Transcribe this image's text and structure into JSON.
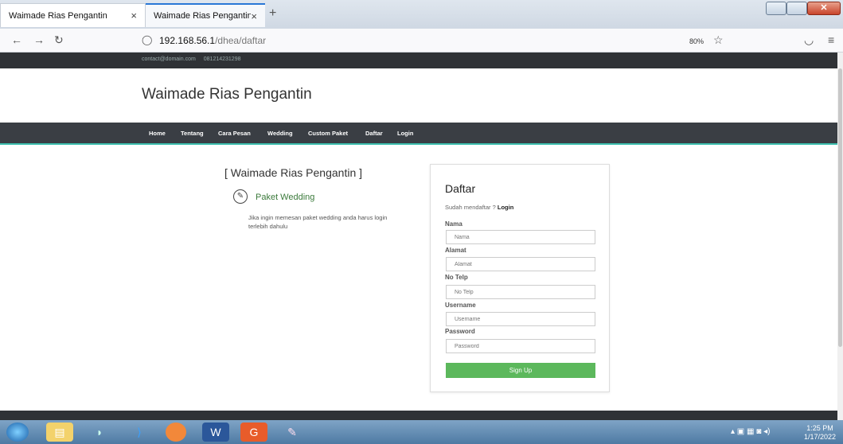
{
  "browser": {
    "tabs": [
      {
        "title": "Waimade Rias Pengantin",
        "close": "×"
      },
      {
        "title": "Waimade Rias Pengantin",
        "close": "×"
      }
    ],
    "new_tab": "+",
    "url_host": "192.168.56.1",
    "url_path": "/dhea/daftar",
    "zoom": "80%"
  },
  "topbar": {
    "email": "contact@domain.com",
    "phone": "081214231298"
  },
  "brand": "Waimade Rias Pengantin",
  "nav": [
    "Home",
    "Tentang",
    "Cara Pesan",
    "Wedding",
    "Custom Paket",
    "Daftar",
    "Login"
  ],
  "left": {
    "title": "[ Waimade Rias Pengantin ]",
    "paket": "Paket Wedding",
    "desc": "Jika ingin memesan paket wedding anda harus login terlebih dahulu"
  },
  "form": {
    "title": "Daftar",
    "already": "Sudah mendaftar ?",
    "login_link": "Login",
    "fields": [
      {
        "label": "Nama",
        "placeholder": "Nama"
      },
      {
        "label": "Alamat",
        "placeholder": "Alamat"
      },
      {
        "label": "No Telp",
        "placeholder": "No Telp"
      },
      {
        "label": "Username",
        "placeholder": "Username"
      },
      {
        "label": "Password",
        "placeholder": "Password"
      }
    ],
    "submit": "Sign Up"
  },
  "taskbar": {
    "time": "1:25 PM",
    "date": "1/17/2022"
  }
}
